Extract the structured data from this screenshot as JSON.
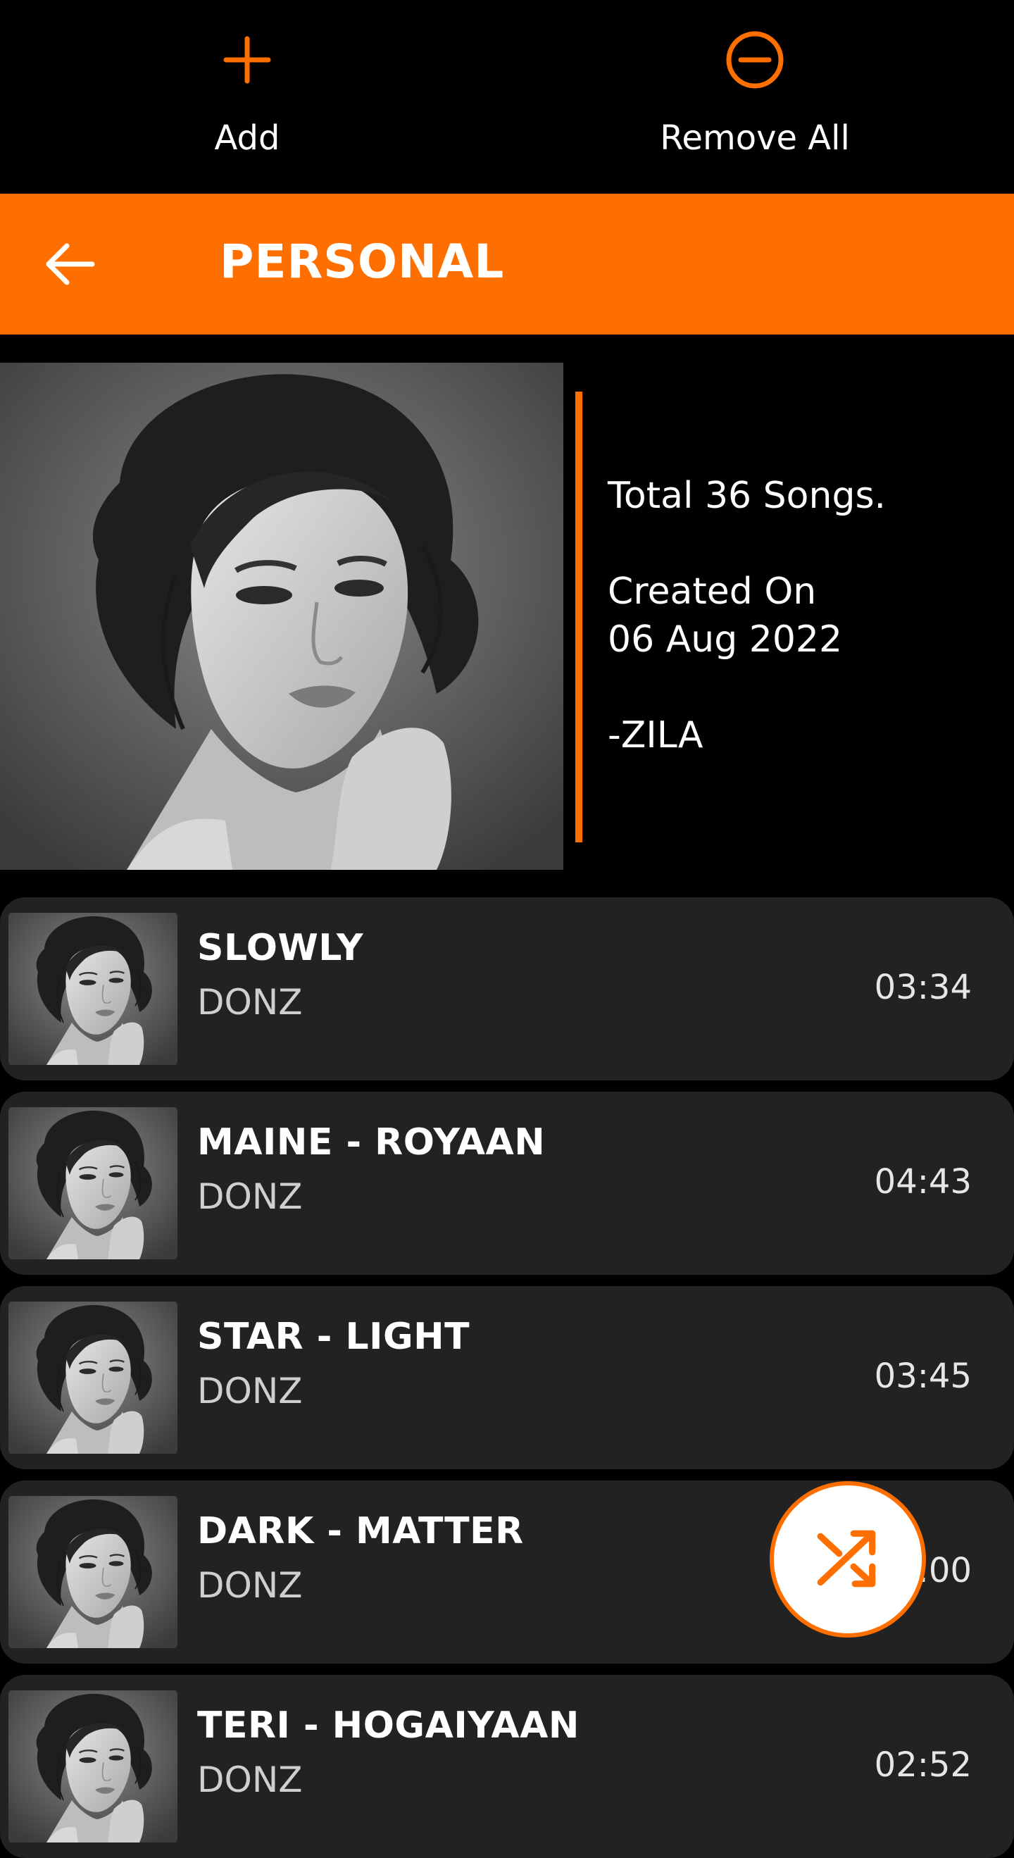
{
  "actions": {
    "add_label": "Add",
    "remove_all_label": "Remove All"
  },
  "header": {
    "title": "PERSONAL"
  },
  "playlist": {
    "total": "Total 36 Songs.",
    "created_label": "Created On",
    "created_date": "06 Aug 2022",
    "owner": "-ZILA"
  },
  "songs": [
    {
      "title": "SLOWLY",
      "artist": "DONZ",
      "duration": "03:34"
    },
    {
      "title": "MAINE - ROYAAN",
      "artist": "DONZ",
      "duration": "04:43"
    },
    {
      "title": "STAR - LIGHT",
      "artist": "DONZ",
      "duration": "03:45"
    },
    {
      "title": "DARK - MATTER",
      "artist": "DONZ",
      "duration": ":00"
    },
    {
      "title": "TERI - HOGAIYAAN",
      "artist": "DONZ",
      "duration": "02:52"
    }
  ],
  "colors": {
    "accent": "#ff6f00",
    "background": "#000000",
    "row": "#222222"
  },
  "icons": {
    "add": "plus-icon",
    "remove_all": "minus-circle-icon",
    "back": "arrow-left-icon",
    "shuffle": "shuffle-icon"
  }
}
